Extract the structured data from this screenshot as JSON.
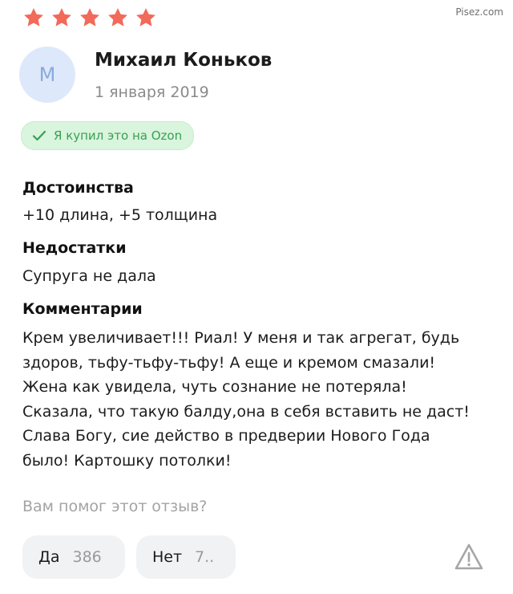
{
  "watermark": "Pisez.com",
  "rating": {
    "value": 5,
    "max": 5,
    "color": "#f16a5a"
  },
  "author": {
    "initial": "М",
    "name": "Михаил Коньков",
    "date": "1 января 2019"
  },
  "badge": {
    "text": "Я купил это на Ozon",
    "icon": "check-icon"
  },
  "sections": {
    "pros": {
      "title": "Достоинства",
      "text": "+10 длина, +5 толщина"
    },
    "cons": {
      "title": "Недостатки",
      "text": "Супруга не дала"
    },
    "comment": {
      "title": "Комментарии",
      "lines": [
        "Крем увеличивает!!! Риал! У меня и так агрегат, будь",
        "здоров, тьфу-тьфу-тьфу! А еще и кремом смазали!",
        "Жена как увидела, чуть сознание не потеряла!",
        "Сказала, что такую балду,она в себя вставить не даст!",
        "Слава Богу, сие действо в предверии Нового Года",
        "было! Картошку потолки!"
      ]
    }
  },
  "helpful": {
    "question": "Вам помог этот отзыв?",
    "yes": {
      "label": "Да",
      "count": "386"
    },
    "no": {
      "label": "Нет",
      "count": "7.."
    },
    "report_icon": "warning-icon"
  }
}
